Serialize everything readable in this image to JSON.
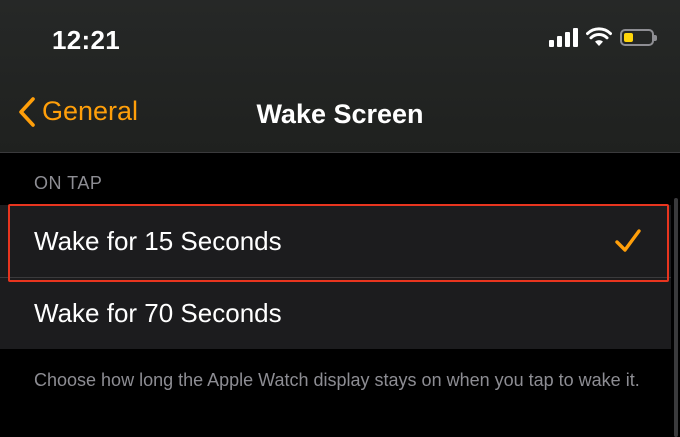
{
  "status_bar": {
    "time": "12:21"
  },
  "nav": {
    "back_label": "General",
    "title": "Wake Screen"
  },
  "section": {
    "header": "ON TAP",
    "options": [
      {
        "label": "Wake for 15 Seconds",
        "selected": true
      },
      {
        "label": "Wake for 70 Seconds",
        "selected": false
      }
    ],
    "footer": "Choose how long the Apple Watch display stays on when you tap to wake it."
  },
  "colors": {
    "accent": "#ff9f0a",
    "highlight": "#e8351f",
    "battery": "#ffd60a"
  },
  "icons": [
    "signal-icon",
    "wifi-icon",
    "battery-icon",
    "chevron-left-icon",
    "checkmark-icon"
  ]
}
